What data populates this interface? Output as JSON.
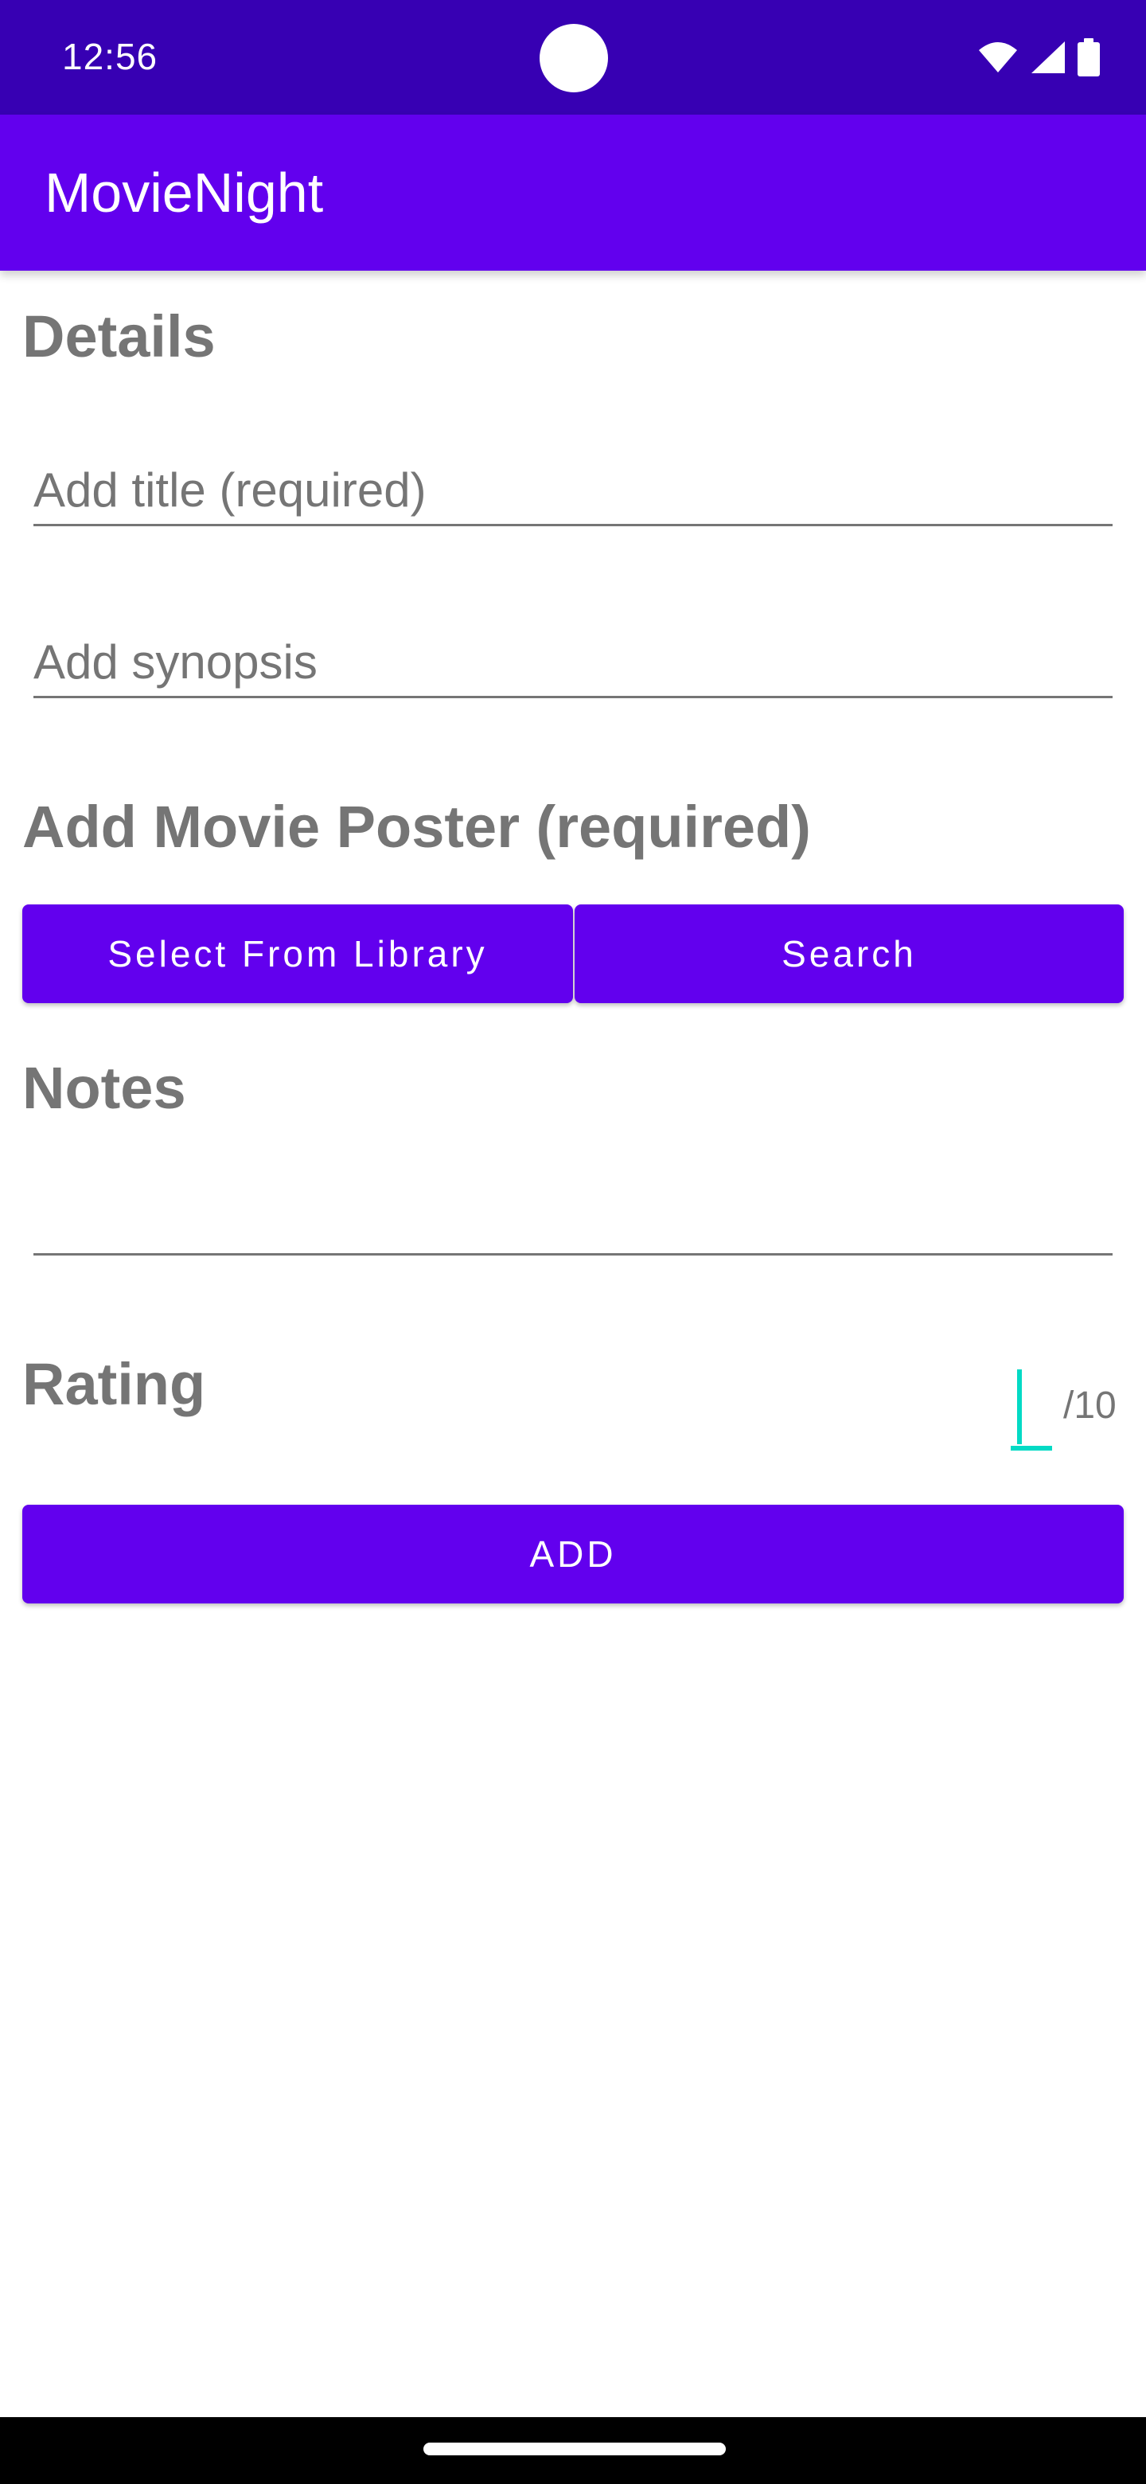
{
  "status_bar": {
    "time": "12:56",
    "icons": [
      "wifi-icon",
      "cellular-signal-icon",
      "battery-icon"
    ],
    "background": "#3700B3"
  },
  "app_bar": {
    "title": "MovieNight",
    "background": "#6200EE"
  },
  "form": {
    "details_heading": "Details",
    "title_placeholder": "Add title (required)",
    "synopsis_placeholder": "Add synopsis",
    "poster_heading": "Add Movie Poster (required)",
    "select_library_label": "Select From Library",
    "search_label": "Search",
    "notes_heading": "Notes",
    "rating_heading": "Rating",
    "rating_suffix": "/10",
    "add_label": "ADD"
  },
  "colors": {
    "primary": "#6200EE",
    "primary_dark": "#3700B3",
    "accent": "#03DAC5",
    "heading_text": "#757575"
  }
}
